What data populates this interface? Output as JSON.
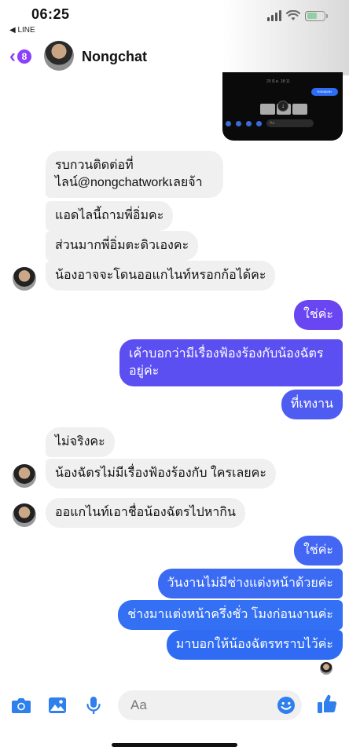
{
  "status_bar": {
    "time": "06:25",
    "back_app": "◀ LINE"
  },
  "header": {
    "back_icon": "chevron-left-icon",
    "unread_count": "8",
    "contact_name": "Nongchat"
  },
  "colors": {
    "accent": "#8a3ffc",
    "outgoing_top": "#7a3ff0",
    "outgoing_bottom": "#2f6cf3",
    "incoming": "#f0f0f0",
    "composer_icon": "#2f80ed"
  },
  "shared_image": {
    "date_text": "20 มี.ค. 18:11",
    "reply_text": "ขอบคุณค่ะ",
    "input_text": "Aa"
  },
  "messages": [
    {
      "side": "in",
      "text_lines": [
        "รบกวนติดต่อที่",
        "ไลน์@nongchatworkเลยจ้า"
      ]
    },
    {
      "side": "in",
      "text": "แอดไลนี้ถามพี่อิ่มคะ"
    },
    {
      "side": "in",
      "text": "ส่วนมากพี่อิ่มตะดิวเองคะ"
    },
    {
      "side": "in",
      "text": "น้องอาจจะโดนออแกไนท์หรอกก้อได้คะ"
    },
    {
      "side": "out",
      "text": "ใช่ค่ะ"
    },
    {
      "side": "out",
      "text_lines": [
        "เค้าบอกว่ามีเรื่องฟ้องร้องกับน้องฉัตร",
        "อยู่ค่ะ"
      ]
    },
    {
      "side": "out",
      "text": "ที่เทงาน"
    },
    {
      "side": "in",
      "text": "ไม่จริงคะ"
    },
    {
      "side": "in",
      "text": "น้องฉัตรไม่มีเรื่องฟ้องร้องกับ ใครเลยคะ"
    },
    {
      "side": "in",
      "text": "ออแกไนท์เอาชื่อน้องฉัตรไปหากิน"
    },
    {
      "side": "out",
      "text": "ใช่ค่ะ"
    },
    {
      "side": "out",
      "text": "วันงานไม่มีช่างแต่งหน้าด้วยค่ะ"
    },
    {
      "side": "out",
      "text": "ช่างมาแต่งหน้าครึ่งชั่ว โมงก่อนงานค่ะ"
    },
    {
      "side": "out",
      "text": "มาบอกให้น้องฉัตรทราบไว้ค่ะ"
    }
  ],
  "composer": {
    "placeholder": "Aa",
    "icons": [
      "camera-icon",
      "photo-icon",
      "microphone-icon",
      "emoji-icon",
      "thumbs-up-icon"
    ]
  }
}
